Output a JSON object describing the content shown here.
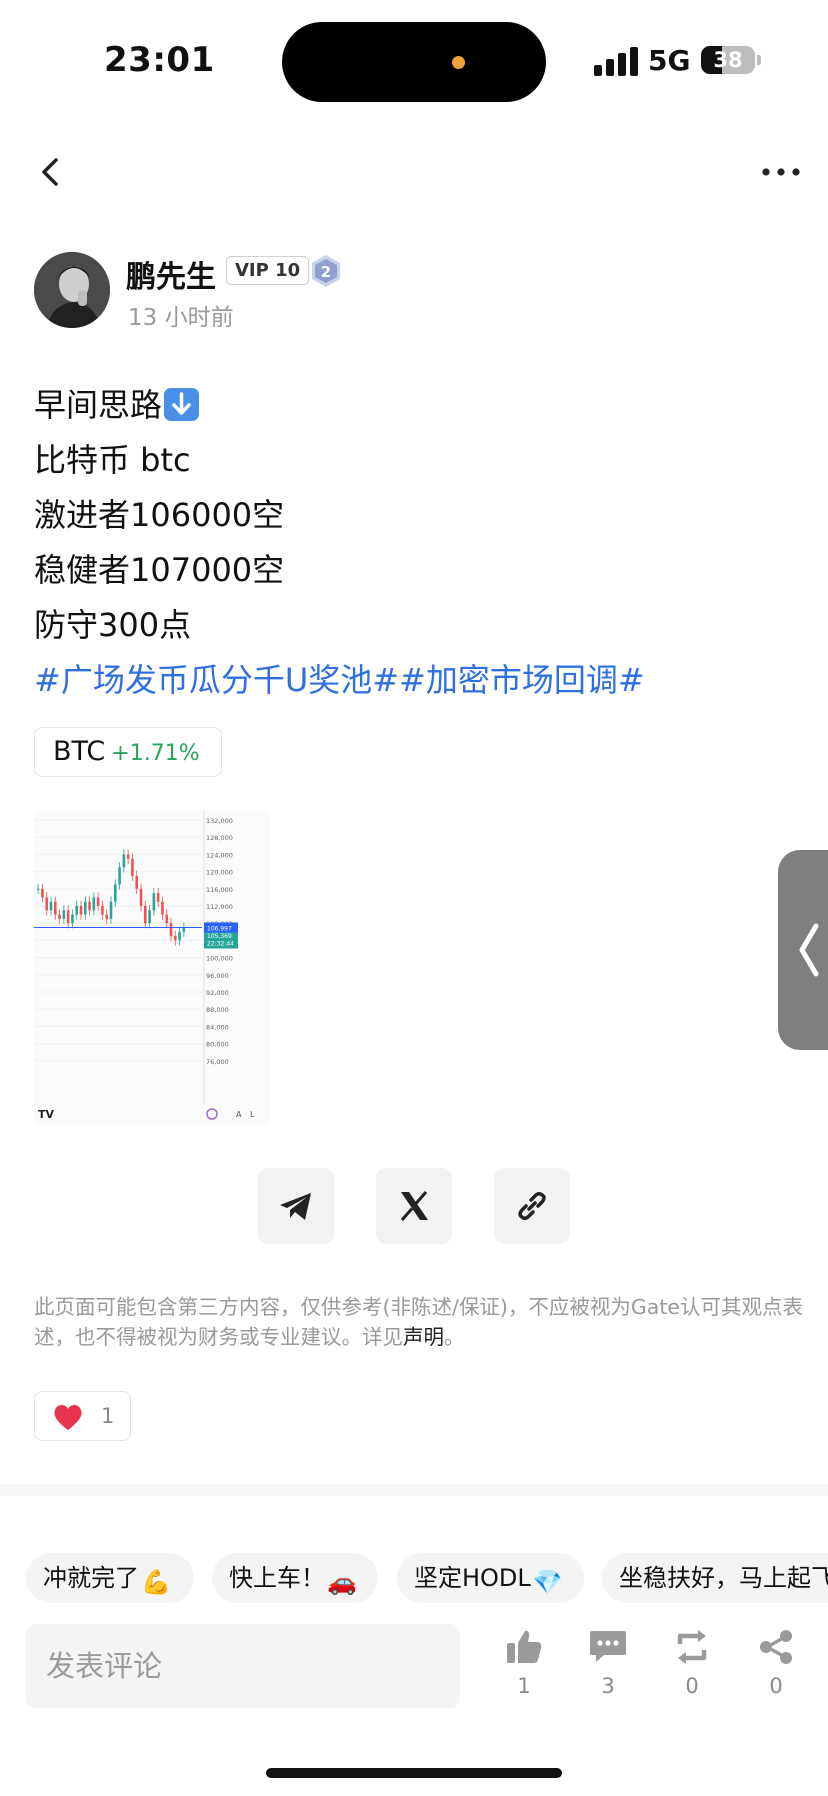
{
  "status_bar": {
    "time": "23:01",
    "network": "5G",
    "battery": "38",
    "battery_level": 0.38
  },
  "nav": {
    "back_icon": "chevron-left-icon",
    "more_icon": "more-horizontal-icon"
  },
  "author": {
    "name": "鹏先生",
    "vip": "VIP 10",
    "level": "2",
    "time_ago": "13 小时前"
  },
  "post": {
    "lines": [
      "早间思路",
      "比特币 btc",
      "激进者106000空",
      "稳健者107000空",
      "防守300点"
    ],
    "hashtags": [
      "#广场发币瓜分千U奖池#",
      "#加密市场回调#"
    ]
  },
  "coin": {
    "symbol": "BTC",
    "change": "+1.71%",
    "change_color": "#27a55c"
  },
  "chart_data": {
    "type": "candlestick",
    "y_ticks": [
      "132,000",
      "128,000",
      "124,000",
      "120,000",
      "116,000",
      "112,000",
      "108,000",
      "104,000",
      "100,000",
      "96,000",
      "92,000",
      "88,000",
      "84,000",
      "80,000",
      "76,000"
    ],
    "price_labels": [
      "106,997",
      "105,369",
      "22:32:44"
    ],
    "footer": [
      "A",
      "L"
    ],
    "colors": {
      "up": "#26a69a",
      "down": "#ef5350",
      "line": "#2962ff"
    }
  },
  "share": {
    "buttons": [
      "telegram-icon",
      "x-icon",
      "link-icon"
    ]
  },
  "disclaimer": {
    "text": "此页面可能包含第三方内容，仅供参考(非陈述/保证)，不应被视为Gate认可其观点表述，也不得被视为财务或专业建议。详见",
    "link": "声明",
    "end": "。"
  },
  "reactions": {
    "heart_count": "1"
  },
  "quick_replies": [
    {
      "text": "冲就完了",
      "emoji": "💪"
    },
    {
      "text": "快上车！",
      "emoji": "🚗"
    },
    {
      "text": "坚定HODL",
      "emoji": "💎"
    },
    {
      "text": "坐稳扶好，马上起飞",
      "emoji": ""
    }
  ],
  "comment": {
    "placeholder": "发表评论"
  },
  "actions": [
    {
      "icon": "thumbs-up-icon",
      "count": "1"
    },
    {
      "icon": "comment-icon",
      "count": "3"
    },
    {
      "icon": "repost-icon",
      "count": "0"
    },
    {
      "icon": "share-icon",
      "count": "0"
    }
  ]
}
